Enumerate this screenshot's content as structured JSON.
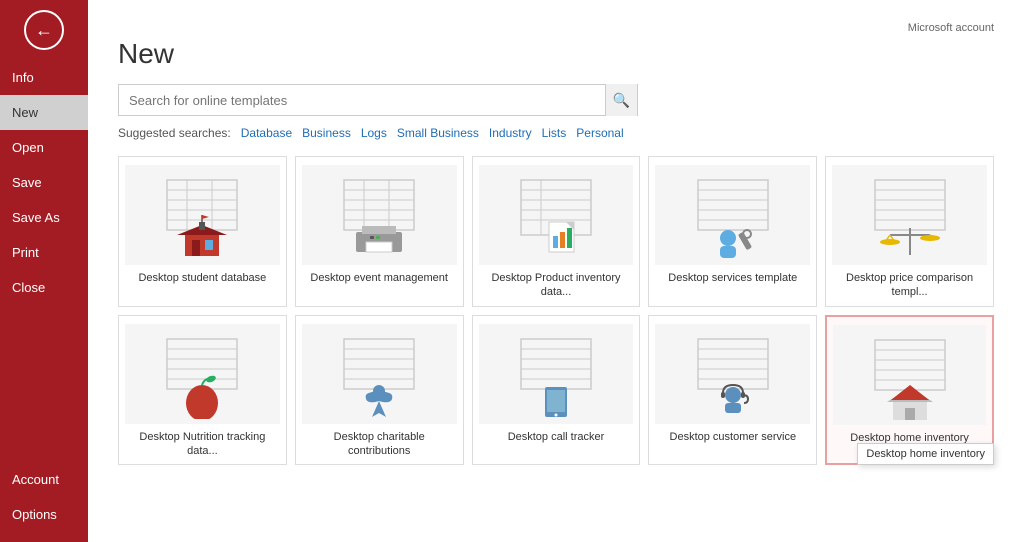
{
  "header": {
    "ms_account": "Microsoft account"
  },
  "sidebar": {
    "back_arrow": "←",
    "items": [
      {
        "id": "info",
        "label": "Info",
        "active": false
      },
      {
        "id": "new",
        "label": "New",
        "active": true
      },
      {
        "id": "open",
        "label": "Open",
        "active": false
      },
      {
        "id": "save",
        "label": "Save",
        "active": false
      },
      {
        "id": "save-as",
        "label": "Save As",
        "active": false
      },
      {
        "id": "print",
        "label": "Print",
        "active": false
      },
      {
        "id": "close",
        "label": "Close",
        "active": false
      }
    ],
    "bottom_items": [
      {
        "id": "account",
        "label": "Account"
      },
      {
        "id": "options",
        "label": "Options"
      }
    ]
  },
  "main": {
    "title": "New",
    "search": {
      "placeholder": "Search for online templates",
      "value": ""
    },
    "suggested_label": "Suggested searches:",
    "suggested_links": [
      "Database",
      "Business",
      "Logs",
      "Small Business",
      "Industry",
      "Lists",
      "Personal"
    ],
    "templates": [
      {
        "id": "student-db",
        "label": "Desktop student database",
        "icon_type": "school"
      },
      {
        "id": "event-mgmt",
        "label": "Desktop event management",
        "icon_type": "printer"
      },
      {
        "id": "product-inv",
        "label": "Desktop Product inventory data...",
        "icon_type": "chart"
      },
      {
        "id": "services",
        "label": "Desktop services template",
        "icon_type": "person-gear"
      },
      {
        "id": "price-compare",
        "label": "Desktop price comparison templ...",
        "icon_type": "scales"
      },
      {
        "id": "nutrition",
        "label": "Desktop Nutrition tracking data...",
        "icon_type": "apple"
      },
      {
        "id": "charitable",
        "label": "Desktop charitable contributions",
        "icon_type": "ribbon"
      },
      {
        "id": "call-tracker",
        "label": "Desktop call tracker",
        "icon_type": "tablet"
      },
      {
        "id": "customer-service",
        "label": "Desktop customer service",
        "icon_type": "headset"
      },
      {
        "id": "home-inv",
        "label": "Desktop home inventory",
        "icon_type": "house",
        "highlighted": true,
        "tooltip": "Desktop home inventory"
      }
    ]
  }
}
